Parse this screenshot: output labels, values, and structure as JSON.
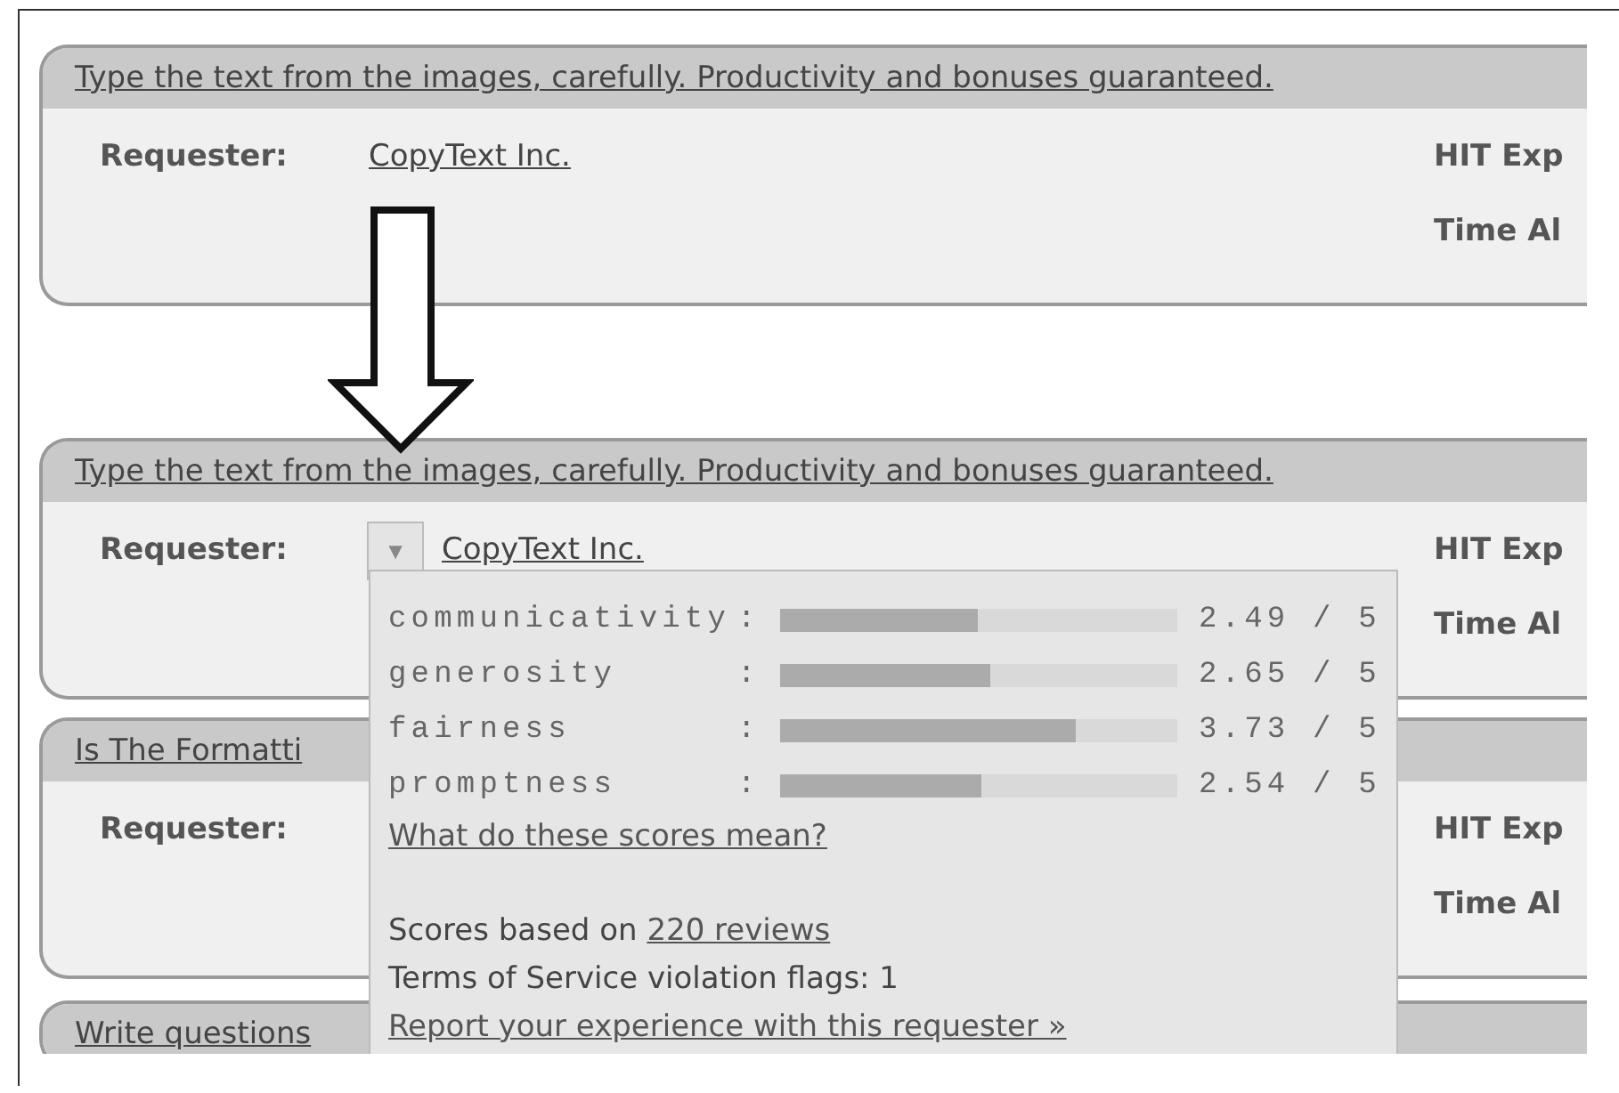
{
  "hits": [
    {
      "title": "Type the text from the images, carefully. Productivity and bonuses guaranteed.",
      "requester_label": "Requester:",
      "requester": "CopyText Inc.",
      "field_1": "HIT Exp",
      "field_2": "Time Al"
    },
    {
      "title": "Type the text from the images, carefully. Productivity and bonuses guaranteed.",
      "requester_label": "Requester:",
      "requester": "CopyText Inc.",
      "field_1": "HIT Exp",
      "field_2": "Time Al",
      "toggle": {
        "glyph": "▼",
        "expanded": true
      }
    },
    {
      "title": "Is The Formatti",
      "requester_label": "Requester:",
      "field_1": "HIT Exp",
      "field_2": "Time Al"
    },
    {
      "title": "Write questions"
    }
  ],
  "scores_popup": {
    "scores": [
      {
        "label": "communicativity",
        "separator": ":",
        "level": 0.498,
        "reading": "2.49 / 5"
      },
      {
        "label": "generosity",
        "separator": ":",
        "level": 0.53,
        "reading": "2.65 / 5"
      },
      {
        "label": "fairness",
        "separator": ":",
        "level": 0.746,
        "reading": "3.73 / 5"
      },
      {
        "label": "promptness",
        "separator": ":",
        "level": 0.508,
        "reading": "2.54 / 5"
      }
    ],
    "help_link": "What do these scores mean?",
    "based_on": "Scores based on ",
    "reviews_link": "220 reviews",
    "flags": "Terms of Service violation flags: 1",
    "report_link": "Report your experience with this requester »"
  }
}
